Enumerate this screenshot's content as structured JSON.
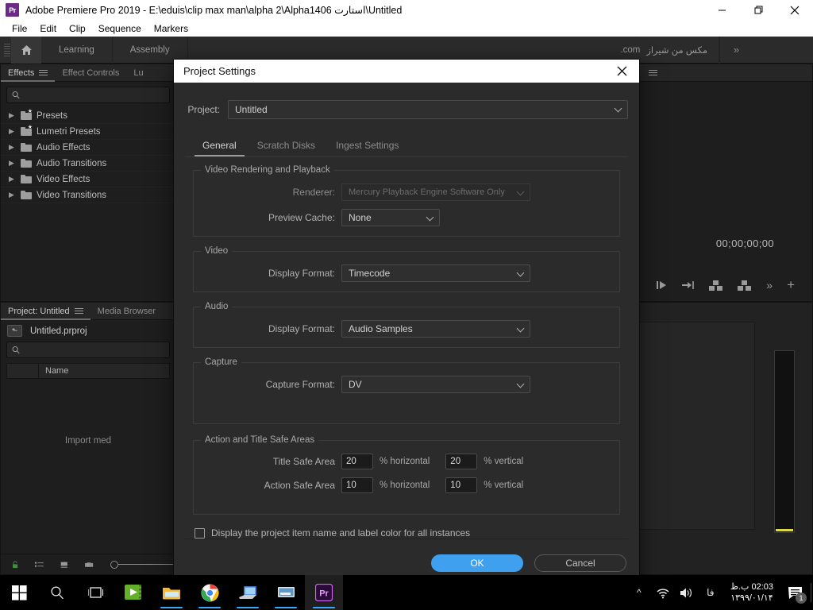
{
  "window": {
    "app_badge": "Pr",
    "title": "Adobe Premiere Pro 2019 - E:\\eduis\\clip max man\\alpha 2\\Alpha1406 استارت\\Untitled",
    "minimize_label": "Minimize",
    "restore_label": "Restore",
    "close_label": "Close"
  },
  "menubar": {
    "items": [
      {
        "label": "File"
      },
      {
        "label": "Edit"
      },
      {
        "label": "Clip"
      },
      {
        "label": "Sequence"
      },
      {
        "label": "Markers"
      }
    ]
  },
  "workspace": {
    "home_icon": "home-icon",
    "tabs": [
      {
        "label": "Learning"
      },
      {
        "label": "Assembly"
      }
    ],
    "watermark": "مکس من شیراز",
    "watermark_suffix": ".com",
    "overflow": "»"
  },
  "effects_panel": {
    "tabs": [
      {
        "label": "Effects",
        "active": true
      },
      {
        "label": "Effect Controls",
        "active": false
      },
      {
        "label": "Lu",
        "active": false
      }
    ],
    "search_placeholder": "",
    "search_value": "",
    "search_icon": "search-icon",
    "tree": [
      {
        "label": "Presets",
        "icon": "folder-star-icon"
      },
      {
        "label": "Lumetri Presets",
        "icon": "folder-star-icon"
      },
      {
        "label": "Audio Effects",
        "icon": "folder-icon"
      },
      {
        "label": "Audio Transitions",
        "icon": "folder-icon"
      },
      {
        "label": "Video Effects",
        "icon": "folder-icon"
      },
      {
        "label": "Video Transitions",
        "icon": "folder-icon"
      }
    ]
  },
  "project_panel": {
    "tabs": [
      {
        "label": "Project: Untitled",
        "active": true
      },
      {
        "label": "Media Browser",
        "active": false
      }
    ],
    "project_file": "Untitled.prproj",
    "search_value": "",
    "column_name": "Name",
    "empty_text": "Import med",
    "footer_icons": [
      "lock-icon",
      "list-view-icon",
      "icon-view-icon",
      "freeform-view-icon",
      "zoom-slider"
    ]
  },
  "monitor": {
    "timecode": "00;00;00;00",
    "tool_icons": [
      "mark-in-icon",
      "mark-out-icon",
      "insert-icon",
      "overwrite-icon",
      "more-icon",
      "add-icon"
    ]
  },
  "dialog": {
    "title": "Project Settings",
    "close_icon": "close-icon",
    "project_label": "Project:",
    "project_value": "Untitled",
    "tabs": [
      {
        "label": "General",
        "active": true
      },
      {
        "label": "Scratch Disks",
        "active": false
      },
      {
        "label": "Ingest Settings",
        "active": false
      }
    ],
    "sections": {
      "video_rendering": {
        "legend": "Video Rendering and Playback",
        "renderer_label": "Renderer:",
        "renderer_value": "Mercury Playback Engine Software Only",
        "renderer_disabled": true,
        "preview_cache_label": "Preview Cache:",
        "preview_cache_value": "None"
      },
      "video": {
        "legend": "Video",
        "display_format_label": "Display Format:",
        "display_format_value": "Timecode"
      },
      "audio": {
        "legend": "Audio",
        "display_format_label": "Display Format:",
        "display_format_value": "Audio Samples"
      },
      "capture": {
        "legend": "Capture",
        "capture_format_label": "Capture Format:",
        "capture_format_value": "DV"
      },
      "safe_areas": {
        "legend": "Action and Title Safe Areas",
        "title_safe_label": "Title Safe Area",
        "title_safe_h": "20",
        "title_safe_v": "20",
        "action_safe_label": "Action Safe Area",
        "action_safe_h": "10",
        "action_safe_v": "10",
        "unit_horizontal": "% horizontal",
        "unit_vertical": "% vertical"
      }
    },
    "checkbox_label": "Display the project item name and label color for all instances",
    "checkbox_checked": false,
    "ok_label": "OK",
    "cancel_label": "Cancel",
    "accent_color": "#3fa0f0"
  },
  "taskbar": {
    "items": [
      {
        "name": "start-button",
        "icon": "windows-icon"
      },
      {
        "name": "search-button",
        "icon": "search-icon"
      },
      {
        "name": "task-view-button",
        "icon": "task-view-icon"
      },
      {
        "name": "media-app-button",
        "icon": "green-media-icon",
        "running": false
      },
      {
        "name": "file-explorer-button",
        "icon": "folder-icon",
        "running": true
      },
      {
        "name": "chrome-button",
        "icon": "chrome-icon",
        "running": true
      },
      {
        "name": "app5-button",
        "icon": "blue-monitor-icon",
        "running": true
      },
      {
        "name": "app6-button",
        "icon": "gray-monitor-icon",
        "running": true
      },
      {
        "name": "premiere-button",
        "icon": "premiere-icon",
        "running": true,
        "active": true
      }
    ],
    "tray": {
      "chevron": "^",
      "network_icon": "wifi-icon",
      "volume_icon": "speaker-icon",
      "language": "فا",
      "time": "02:03 ب.ظ",
      "date": "۱۳۹۹/۰۱/۱۴",
      "notification_count": "1"
    }
  }
}
